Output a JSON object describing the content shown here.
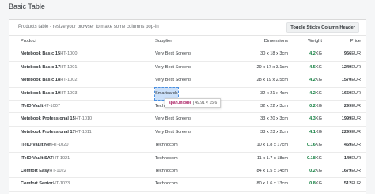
{
  "page_title": "Basic Table",
  "toolbar": {
    "text": "Products table - resize your browser to make some columns pop-in",
    "toggle_button": "Toggle Sticky Column Header"
  },
  "columns": {
    "product": "Product",
    "supplier": "Supplier",
    "dimensions": "Dimensions",
    "weight": "Weight",
    "price": "Price"
  },
  "rows": [
    {
      "name": "Notebook Basic 15",
      "id": "HT-1000",
      "supplier": "Very Best Screens",
      "dimensions": "30 x 18 x 3cm",
      "weight": "4.2",
      "weight_unit": "KG",
      "price": "956",
      "currency": "EUR"
    },
    {
      "name": "Notebook Basic 17",
      "id": "HT-1001",
      "supplier": "Very Best Screens",
      "dimensions": "29 x 17 x 3.1cm",
      "weight": "4.5",
      "weight_unit": "KG",
      "price": "1249",
      "currency": "EUR"
    },
    {
      "name": "Notebook Basic 18",
      "id": "HT-1002",
      "supplier": "Very Best Screens",
      "dimensions": "28 x 19 x 2.5cm",
      "weight": "4.2",
      "weight_unit": "KG",
      "price": "1570",
      "currency": "EUR"
    },
    {
      "name": "Notebook Basic 19",
      "id": "HT-1003",
      "supplier": "Smartcards",
      "dimensions": "32 x 21 x 4cm",
      "weight": "4.2",
      "weight_unit": "KG",
      "price": "1650",
      "currency": "EUR"
    },
    {
      "name": "ITelO Vault",
      "id": "HT-1007",
      "supplier": "Technocom",
      "dimensions": "32 x 22 x 3cm",
      "weight": "0.2",
      "weight_unit": "KG",
      "price": "299",
      "currency": "EUR"
    },
    {
      "name": "Notebook Professional 15",
      "id": "HT-1010",
      "supplier": "Very Best Screens",
      "dimensions": "33 x 20 x 3cm",
      "weight": "4.3",
      "weight_unit": "KG",
      "price": "1999",
      "currency": "EUR"
    },
    {
      "name": "Notebook Professional 17",
      "id": "HT-1011",
      "supplier": "Very Best Screens",
      "dimensions": "33 x 23 x 2cm",
      "weight": "4.1",
      "weight_unit": "KG",
      "price": "2299",
      "currency": "EUR"
    },
    {
      "name": "ITelO Vault Net",
      "id": "HT-1020",
      "supplier": "Technocom",
      "dimensions": "10 x 1.8 x 17cm",
      "weight": "0.16",
      "weight_unit": "KG",
      "price": "459",
      "currency": "EUR"
    },
    {
      "name": "ITelO Vault SAT",
      "id": "HT-1021",
      "supplier": "Technocom",
      "dimensions": "11 x 1.7 x 18cm",
      "weight": "0.18",
      "weight_unit": "KG",
      "price": "149",
      "currency": "EUR"
    },
    {
      "name": "Comfort Easy",
      "id": "HT-1022",
      "supplier": "Technocom",
      "dimensions": "84 x 1.5 x 14cm",
      "weight": "0.2",
      "weight_unit": "KG",
      "price": "1679",
      "currency": "EUR"
    },
    {
      "name": "Comfort Senior",
      "id": "HT-1023",
      "supplier": "Technocom",
      "dimensions": "80 x 1.6 x 13cm",
      "weight": "0.8",
      "weight_unit": "KG",
      "price": "512",
      "currency": "EUR"
    }
  ],
  "tooltip": {
    "tag": "span.middle",
    "dims": "49.91 × 15.6"
  },
  "colors": {
    "weight_positive": "#107e3e",
    "highlight": "#6eaaf0"
  }
}
